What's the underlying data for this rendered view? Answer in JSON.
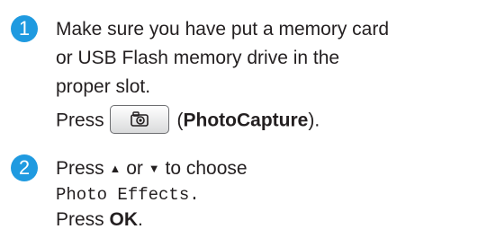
{
  "steps": [
    {
      "number": "1",
      "lines": [
        "Make sure you have put a memory card",
        "or USB Flash memory drive in the",
        "proper slot."
      ],
      "press_prefix": "Press",
      "button_label": "PhotoCapture",
      "button_icon": "camera-icon",
      "paren_open": " (",
      "paren_close": ")."
    },
    {
      "number": "2",
      "press1": "Press",
      "up_arrow": "▲",
      "or": "or",
      "down_arrow": "▼",
      "choose": "to choose",
      "menu_option": "Photo Effects.",
      "press2": "Press",
      "ok": "OK",
      "period": "."
    }
  ],
  "colors": {
    "badge": "#1f9ae0",
    "text": "#231f20"
  }
}
